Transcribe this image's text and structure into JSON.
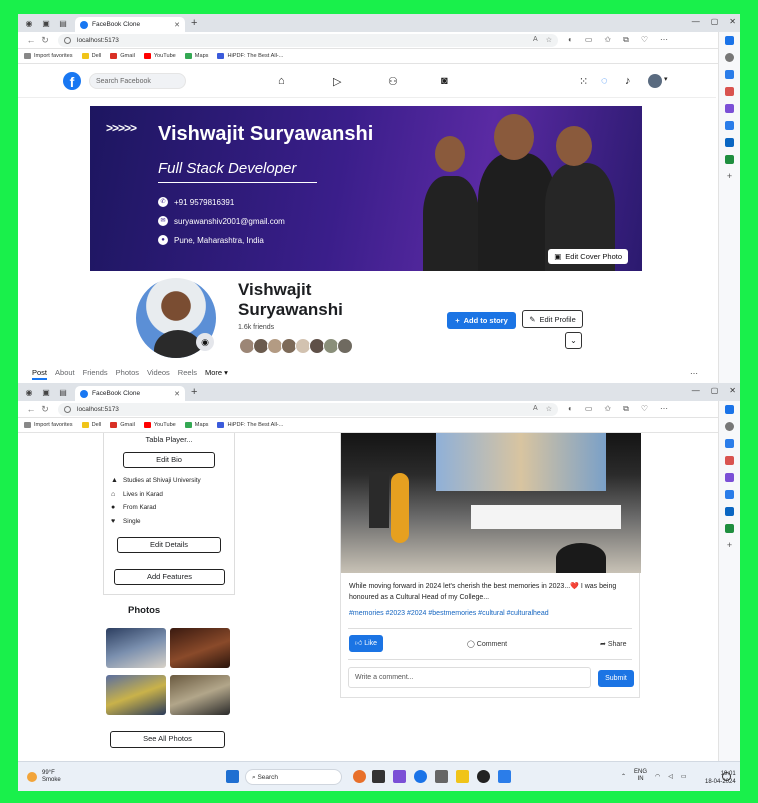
{
  "browser": {
    "tab_title": "FaceBook Clone",
    "url": "localhost:5173",
    "bookmarks": [
      "Import favorites",
      "Dell",
      "Gmail",
      "YouTube",
      "Maps",
      "HiPDF: The Best All-..."
    ]
  },
  "fb_nav": {
    "search_placeholder": "Search Facebook"
  },
  "cover": {
    "name": "Vishwajit Suryawanshi",
    "role": "Full Stack Developer",
    "phone": "+91 9579816391",
    "email": "suryawanshiv2001@gmail.com",
    "location": "Pune, Maharashtra, India",
    "edit_cover_label": "Edit Cover Photo"
  },
  "profile": {
    "name": "Vishwajit Suryawanshi",
    "friends": "1.6k friends",
    "add_story_label": "Add to story",
    "edit_profile_label": "Edit Profile"
  },
  "profile_tabs": [
    "Post",
    "About",
    "Friends",
    "Photos",
    "Videos",
    "Reels",
    "More"
  ],
  "intro": {
    "bio": "Tabla Player...",
    "edit_bio": "Edit Bio",
    "details": [
      "Studies at Shivaji University",
      "Lives in Karad",
      "From Karad",
      "Single"
    ],
    "edit_details": "Edit Details",
    "add_features": "Add Features"
  },
  "photos": {
    "title": "Photos",
    "see_all": "See All Photos"
  },
  "post": {
    "text": "While moving forward in 2024 let's cherish the best memories in 2023...❤️ I was being honoured as a Cultural Head of my College...",
    "tags": "#memories #2023 #2024 #bestmemories #cultural #culturalhead",
    "like": "Like",
    "comment": "Comment",
    "share": "Share",
    "comment_placeholder": "Write a comment...",
    "submit": "Submit"
  },
  "taskbar": {
    "temp": "99°F",
    "condition": "Smoke",
    "search": "Search",
    "lang_top": "ENG",
    "lang_bottom": "IN",
    "time": "19:01",
    "date": "18-04-2024"
  }
}
